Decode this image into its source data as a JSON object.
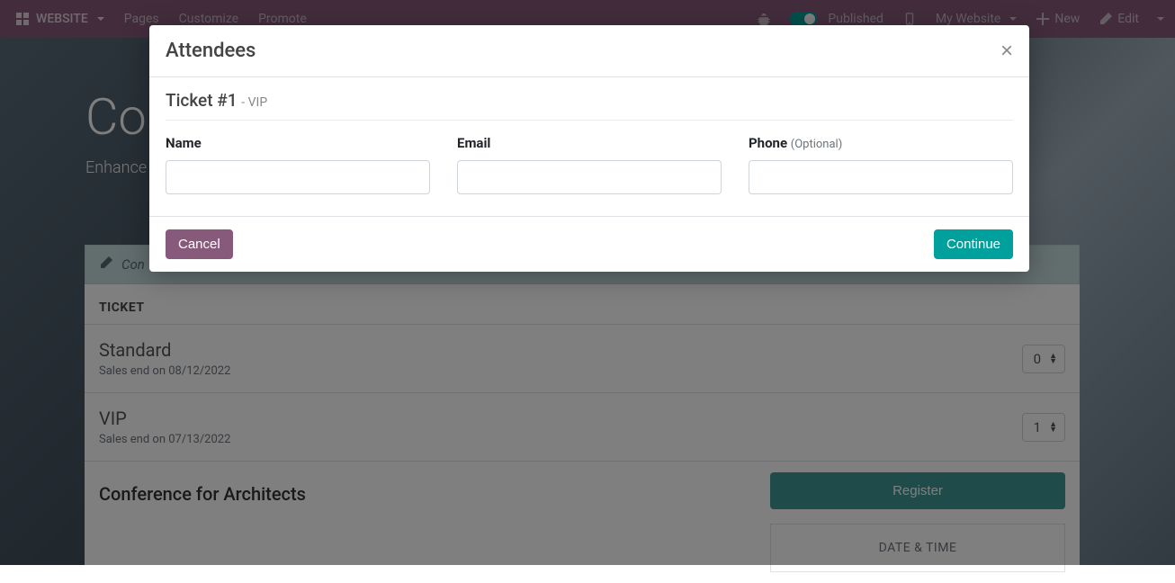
{
  "nav": {
    "website": "WEBSITE",
    "pages": "Pages",
    "customize": "Customize",
    "promote": "Promote",
    "published": "Published",
    "my_website": "My Website",
    "new": "New",
    "edit": "Edit"
  },
  "hero": {
    "title_partial": "Co",
    "subtitle_partial": "Enhance"
  },
  "alert": {
    "text_partial": "Con"
  },
  "tickets": {
    "header": "TICKET",
    "items": [
      {
        "name": "Standard",
        "sales": "Sales end on 08/12/2022",
        "qty": "0"
      },
      {
        "name": "VIP",
        "sales": "Sales end on 07/13/2022",
        "qty": "1"
      }
    ],
    "register": "Register"
  },
  "content": {
    "section_title": "Conference for Architects"
  },
  "sidebar": {
    "datetime": "DATE & TIME"
  },
  "modal": {
    "title": "Attendees",
    "ticket_label": "Ticket #1",
    "ticket_type": "- VIP",
    "name_label": "Name",
    "email_label": "Email",
    "phone_label": "Phone",
    "phone_optional": "(Optional)",
    "cancel": "Cancel",
    "continue": "Continue"
  }
}
